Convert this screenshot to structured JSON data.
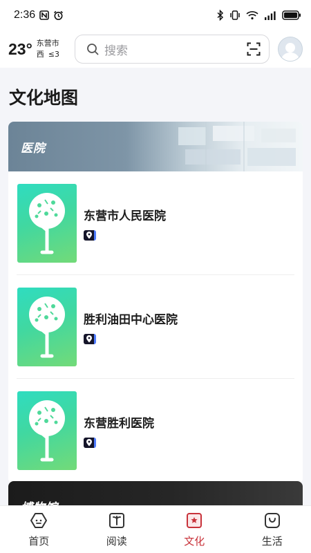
{
  "status_bar": {
    "time": "2:36",
    "icons": [
      "nfc-icon",
      "alarm-icon",
      "bluetooth-icon",
      "vibrate-icon",
      "wifi-icon",
      "signal-icon",
      "battery-icon"
    ]
  },
  "header": {
    "temperature": "23°",
    "city": "东营市",
    "wind_dir": "西",
    "wind_level": "≤3",
    "search_placeholder": "搜索"
  },
  "page_title": "文化地图",
  "categories": [
    {
      "title": "医院",
      "items": [
        {
          "name": "东营市人民医院"
        },
        {
          "name": "胜利油田中心医院"
        },
        {
          "name": "东营胜利医院"
        }
      ]
    },
    {
      "title": "博物馆"
    }
  ],
  "bottom_nav": [
    {
      "label": "首页",
      "icon": "home-icon",
      "active": false
    },
    {
      "label": "阅读",
      "icon": "book-icon",
      "active": false
    },
    {
      "label": "文化",
      "icon": "culture-icon",
      "active": true
    },
    {
      "label": "生活",
      "icon": "life-icon",
      "active": false
    }
  ],
  "colors": {
    "accent": "#c8323a",
    "thumb_gradient_start": "#2fdcc0",
    "thumb_gradient_end": "#73da78",
    "banner": "#6c8497"
  }
}
